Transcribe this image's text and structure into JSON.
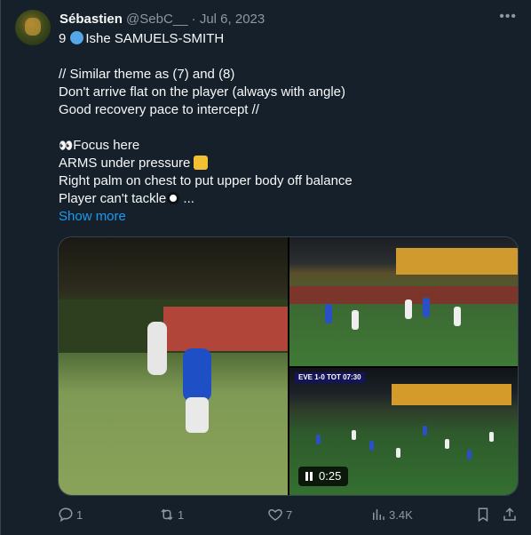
{
  "tweet": {
    "author_name": "Sébastien",
    "author_handle": "@SebC__",
    "separator": "·",
    "date": "Jul 6, 2023",
    "lines": [
      "9",
      "Ishe SAMUELS-SMITH",
      "// Similar theme as (7) and (8)",
      "Don't arrive flat on the player (always with angle)",
      "Good recovery pace to intercept //",
      "Focus here",
      "ARMS under pressure",
      "Right palm on chest to put upper body off balance",
      "Player can't tackle",
      " ..."
    ],
    "show_more": "Show more"
  },
  "media": {
    "scoreboard": "EVE  1-0  TOT  07:30",
    "duration": "0:25"
  },
  "actions": {
    "replies": "1",
    "reposts": "1",
    "likes": "7",
    "views": "3.4K"
  },
  "icons": {
    "more": "ellipsis-icon",
    "reply": "reply-icon",
    "repost": "repost-icon",
    "like": "heart-icon",
    "views": "views-icon",
    "bookmark": "bookmark-icon",
    "share": "share-icon"
  },
  "colors": {
    "background": "#15202b",
    "accent": "#1d9bf0",
    "muted": "#8b98a5"
  }
}
